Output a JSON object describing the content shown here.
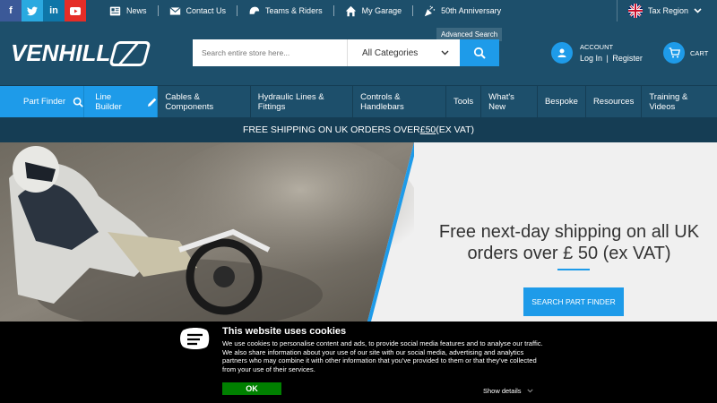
{
  "colors": {
    "header_bg": "#1d4f6b",
    "accent": "#1e9be9",
    "shipbar_bg": "#153d54",
    "cookie_ok": "#008000"
  },
  "social": [
    {
      "icon": "facebook-icon",
      "glyph": "f"
    },
    {
      "icon": "twitter-icon",
      "glyph": "t"
    },
    {
      "icon": "linkedin-icon",
      "glyph": "in"
    },
    {
      "icon": "youtube-icon",
      "glyph": "▶"
    }
  ],
  "toplinks": {
    "news": "News",
    "contact": "Contact Us",
    "teams": "Teams & Riders",
    "garage": "My Garage",
    "anniversary": "50th Anniversary"
  },
  "tax_region": "Tax Region",
  "logo_text": "VENHILL",
  "search": {
    "advanced_label": "Advanced Search",
    "placeholder": "Search entire store here...",
    "category": "All Categories"
  },
  "account": {
    "label": "ACCOUNT",
    "login": "Log In",
    "register": "Register"
  },
  "cart": {
    "label": "CART"
  },
  "nav": {
    "part_finder": "Part Finder",
    "line_builder": "Line Builder",
    "items": [
      "Cables & Components",
      "Hydraulic Lines & Fittings",
      "Controls & Handlebars",
      "Tools",
      "What's New",
      "Bespoke",
      "Resources",
      "Training & Videos"
    ]
  },
  "shipping_bar": {
    "prefix": "FREE SHIPPING ON UK ORDERS OVER ",
    "amount": "£50",
    "suffix": " (EX VAT)"
  },
  "hero": {
    "line1": "Free next-day shipping on all UK",
    "line2": "orders over £ 50 (ex VAT)",
    "button": "SEARCH PART FINDER"
  },
  "cookie": {
    "title": "This website uses cookies",
    "body": "We use cookies to personalise content and ads, to provide social media features and to analyse our traffic. We also share information about your use of our site with our social media, advertising and analytics partners who may combine it with other information that you've provided to them or that they've collected from your use of their services.",
    "ok": "OK",
    "details": "Show details"
  }
}
